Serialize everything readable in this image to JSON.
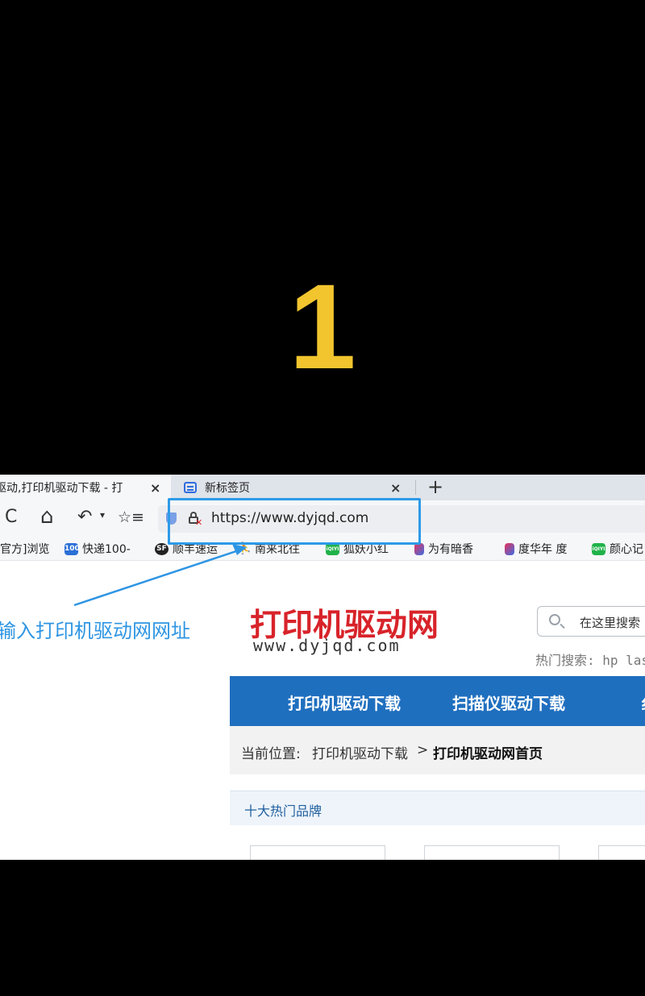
{
  "step_number": "1",
  "browser": {
    "tabs": [
      {
        "title": "驱动,打印机驱动下载 - 打",
        "close": "×",
        "active": true
      },
      {
        "title": "新标签页",
        "close": "×",
        "active": false
      }
    ],
    "new_tab": "+",
    "nav": {
      "refresh": "C",
      "home": "⌂",
      "undo": "↶",
      "undo_dropdown": "▾",
      "favorite": "☆≡"
    },
    "url": "https://www.dyjqd.com",
    "bookmarks": [
      {
        "label": "官方]浏览",
        "icon": ""
      },
      {
        "label": "快递100-",
        "icon": "100"
      },
      {
        "label": "顺丰速运",
        "icon": "SF"
      },
      {
        "label": "南来北往",
        "icon": ""
      },
      {
        "label": "狐妖小红",
        "icon": "iQIYI"
      },
      {
        "label": "为有暗香",
        "icon": ""
      },
      {
        "label": "度华年 度",
        "icon": ""
      },
      {
        "label": "颜心记",
        "icon": "iQIYI"
      }
    ]
  },
  "annotation": "输入打印机驱动网网址",
  "site": {
    "logo_text": "打印机驱动网",
    "logo_url": "www.dyjqd.com",
    "search_placeholder": "在这里搜索",
    "hot_search": "热门搜索: hp las",
    "nav_items": [
      "打印机驱动下载",
      "扫描仪驱动下载",
      "纟"
    ],
    "breadcrumb": {
      "label": "当前位置:",
      "link": "打印机驱动下载",
      "sep": ">",
      "current": "打印机驱动网首页"
    },
    "section_title": "十大热门品牌"
  },
  "colors": {
    "step_number": "#f2c52f",
    "highlight": "#2d9ae8",
    "logo": "#d8232a",
    "nav_bg": "#1f6fbf"
  }
}
